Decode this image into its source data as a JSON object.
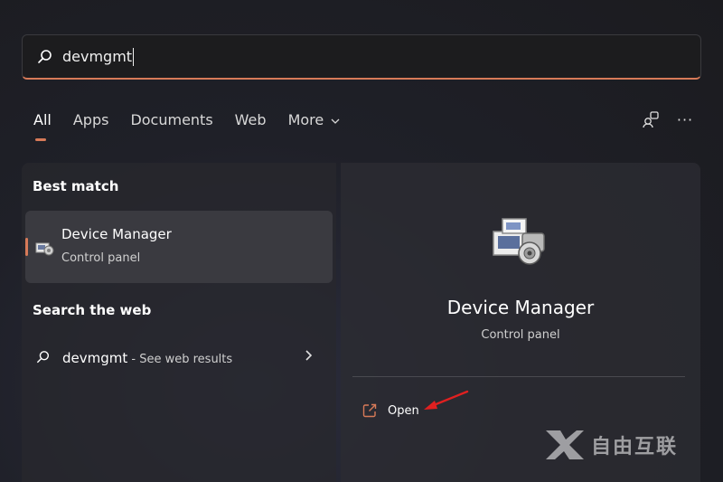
{
  "search": {
    "query": "devmgmt"
  },
  "tabs": [
    {
      "label": "All",
      "active": true
    },
    {
      "label": "Apps"
    },
    {
      "label": "Documents"
    },
    {
      "label": "Web"
    },
    {
      "label": "More"
    }
  ],
  "toolbar": {
    "more_options_label": "···"
  },
  "left": {
    "best_match_title": "Best match",
    "best_match": {
      "name": "Device Manager",
      "subtitle": "Control panel"
    },
    "web_title": "Search the web",
    "web_result": {
      "term": "devmgmt",
      "hint": " - See web results"
    }
  },
  "right": {
    "app_name": "Device Manager",
    "app_subtitle": "Control panel",
    "open_label": "Open"
  },
  "watermark": {
    "text": "自由互联"
  },
  "colors": {
    "accent": "#d77a58",
    "annotation_arrow": "#e02020"
  },
  "icons": [
    "search-icon",
    "device-manager-icon",
    "open-external-icon",
    "chevron-right-icon",
    "chevron-down-icon",
    "account-switch-icon"
  ]
}
